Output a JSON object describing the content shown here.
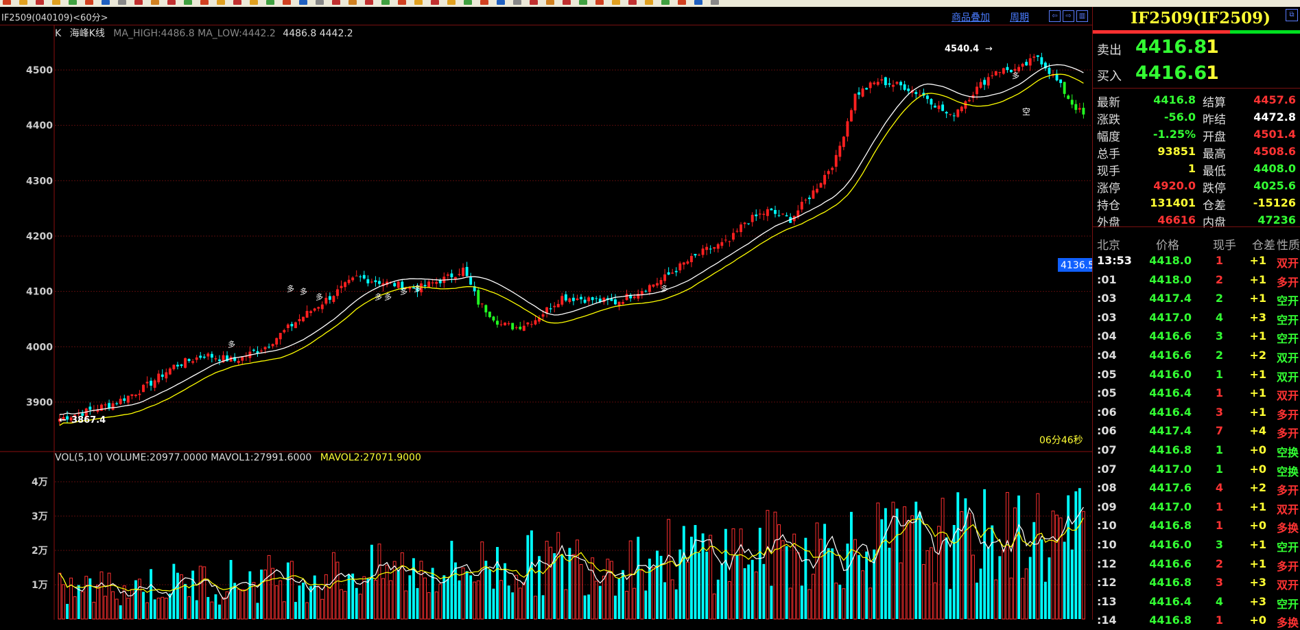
{
  "title_bar": {
    "symbol_label": "IF2509(040109)<60分>",
    "link_overlay": "商品叠加",
    "link_period": "周期"
  },
  "main_chart": {
    "indicator_k": "K",
    "indicator_name": "海峰K线",
    "ma_text": "MA_HIGH:4486.8 MA_LOW:4442.2",
    "ma_values": "4486.8 4442.2",
    "y_ticks": [
      "4500",
      "4400",
      "4300",
      "4200",
      "4100",
      "4000",
      "3900"
    ],
    "high_label": "4540.4",
    "low_label": "3867.4",
    "current_price_tag": "4136.5",
    "countdown": "06分46秒",
    "annotation_glyph": "多",
    "annotation_glyph_short": "空"
  },
  "volume_chart": {
    "legend_main": "VOL(5,10) VOLUME:20977.0000 MAVOL1:27991.6000",
    "legend_mavol2": "MAVOL2:27071.9000",
    "y_ticks": [
      "4万",
      "3万",
      "2万",
      "1万"
    ]
  },
  "chart_data": [
    {
      "type": "candlestick",
      "title": "海峰K线",
      "ylim": [
        3840,
        4580
      ],
      "y_ticks": [
        3900,
        4000,
        4100,
        4200,
        4300,
        4400,
        4500
      ],
      "annotations": [
        {
          "text": "4540.4",
          "value": 4540.4
        },
        {
          "text": "3867.4",
          "value": 3867.4
        }
      ],
      "series": [
        {
          "name": "MA_HIGH",
          "last": 4486.8
        },
        {
          "name": "MA_LOW",
          "last": 4442.2
        }
      ],
      "keypoints": [
        [
          0,
          3870
        ],
        [
          8,
          3885
        ],
        [
          15,
          3900
        ],
        [
          22,
          3925
        ],
        [
          30,
          3965
        ],
        [
          38,
          3985
        ],
        [
          46,
          3975
        ],
        [
          54,
          4000
        ],
        [
          62,
          4045
        ],
        [
          70,
          4085
        ],
        [
          78,
          4125
        ],
        [
          86,
          4115
        ],
        [
          94,
          4105
        ],
        [
          102,
          4125
        ],
        [
          106,
          4140
        ],
        [
          110,
          4080
        ],
        [
          116,
          4040
        ],
        [
          120,
          4035
        ],
        [
          125,
          4050
        ],
        [
          132,
          4090
        ],
        [
          140,
          4085
        ],
        [
          146,
          4080
        ],
        [
          152,
          4100
        ],
        [
          158,
          4120
        ],
        [
          164,
          4150
        ],
        [
          170,
          4175
        ],
        [
          176,
          4190
        ],
        [
          180,
          4225
        ],
        [
          186,
          4245
        ],
        [
          192,
          4230
        ],
        [
          198,
          4280
        ],
        [
          204,
          4340
        ],
        [
          209,
          4455
        ],
        [
          215,
          4480
        ],
        [
          222,
          4470
        ],
        [
          228,
          4450
        ],
        [
          234,
          4415
        ],
        [
          240,
          4460
        ],
        [
          246,
          4500
        ],
        [
          252,
          4500
        ],
        [
          257,
          4525
        ],
        [
          262,
          4480
        ],
        [
          266,
          4440
        ],
        [
          269,
          4418
        ]
      ]
    },
    {
      "type": "bar",
      "title": "VOL(5,10)",
      "ylim": [
        0,
        45000
      ],
      "y_ticks": [
        10000,
        20000,
        30000,
        40000
      ],
      "series": [
        {
          "name": "VOLUME",
          "last": 20977
        },
        {
          "name": "MAVOL1",
          "last": 27991.6
        },
        {
          "name": "MAVOL2",
          "last": 27071.9
        }
      ]
    }
  ],
  "right_panel": {
    "title": "IF2509(IF2509)",
    "sell_label": "卖出",
    "sell_price": "4416.8",
    "sell_vol": "1",
    "buy_label": "买入",
    "buy_price": "4416.6",
    "buy_vol": "1",
    "stats_left": [
      {
        "label": "最新",
        "value": "4416.8",
        "color": "green"
      },
      {
        "label": "涨跌",
        "value": "-56.0",
        "color": "green"
      },
      {
        "label": "幅度",
        "value": "-1.25%",
        "color": "green"
      },
      {
        "label": "总手",
        "value": "93851",
        "color": "yellow"
      },
      {
        "label": "现手",
        "value": "1",
        "color": "yellow"
      },
      {
        "label": "涨停",
        "value": "4920.0",
        "color": "red"
      },
      {
        "label": "持仓",
        "value": "131401",
        "color": "yellow"
      },
      {
        "label": "外盘",
        "value": "46616",
        "color": "red"
      }
    ],
    "stats_right": [
      {
        "label": "结算",
        "value": "4457.6",
        "color": "red"
      },
      {
        "label": "昨结",
        "value": "4472.8",
        "color": "white"
      },
      {
        "label": "开盘",
        "value": "4501.4",
        "color": "red"
      },
      {
        "label": "最高",
        "value": "4508.6",
        "color": "red"
      },
      {
        "label": "最低",
        "value": "4408.0",
        "color": "green"
      },
      {
        "label": "跌停",
        "value": "4025.6",
        "color": "green"
      },
      {
        "label": "仓差",
        "value": "-15126",
        "color": "yellow"
      },
      {
        "label": "内盘",
        "value": "47236",
        "color": "green"
      }
    ],
    "tick_headers": [
      "北京",
      "价格",
      "现手",
      "仓差",
      "性质"
    ],
    "ticks": [
      {
        "time": "13:53",
        "price": "4418.0",
        "vol": "1",
        "oi": "+1",
        "nature": "双开",
        "ncolor": "red"
      },
      {
        "time": ":01",
        "price": "4418.0",
        "vol": "2",
        "oi": "+1",
        "nature": "多开",
        "ncolor": "red"
      },
      {
        "time": ":03",
        "price": "4417.4",
        "vol": "2",
        "oi": "+1",
        "nature": "空开",
        "ncolor": "green"
      },
      {
        "time": ":03",
        "price": "4417.0",
        "vol": "4",
        "oi": "+3",
        "nature": "空开",
        "ncolor": "green"
      },
      {
        "time": ":04",
        "price": "4416.6",
        "vol": "3",
        "oi": "+1",
        "nature": "空开",
        "ncolor": "green"
      },
      {
        "time": ":04",
        "price": "4416.6",
        "vol": "2",
        "oi": "+2",
        "nature": "双开",
        "ncolor": "green"
      },
      {
        "time": ":05",
        "price": "4416.0",
        "vol": "1",
        "oi": "+1",
        "nature": "双开",
        "ncolor": "green"
      },
      {
        "time": ":05",
        "price": "4416.4",
        "vol": "1",
        "oi": "+1",
        "nature": "双开",
        "ncolor": "red"
      },
      {
        "time": ":06",
        "price": "4416.4",
        "vol": "3",
        "oi": "+1",
        "nature": "多开",
        "ncolor": "red"
      },
      {
        "time": ":06",
        "price": "4417.4",
        "vol": "7",
        "oi": "+4",
        "nature": "多开",
        "ncolor": "red"
      },
      {
        "time": ":07",
        "price": "4416.8",
        "vol": "1",
        "oi": "+0",
        "nature": "空换",
        "ncolor": "green"
      },
      {
        "time": ":07",
        "price": "4417.0",
        "vol": "1",
        "oi": "+0",
        "nature": "空换",
        "ncolor": "green"
      },
      {
        "time": ":08",
        "price": "4417.6",
        "vol": "4",
        "oi": "+2",
        "nature": "多开",
        "ncolor": "red"
      },
      {
        "time": ":09",
        "price": "4417.0",
        "vol": "1",
        "oi": "+1",
        "nature": "双开",
        "ncolor": "red"
      },
      {
        "time": ":10",
        "price": "4416.8",
        "vol": "1",
        "oi": "+0",
        "nature": "多换",
        "ncolor": "red"
      },
      {
        "time": ":10",
        "price": "4416.0",
        "vol": "3",
        "oi": "+1",
        "nature": "空开",
        "ncolor": "green"
      },
      {
        "time": ":12",
        "price": "4416.6",
        "vol": "2",
        "oi": "+1",
        "nature": "多开",
        "ncolor": "red"
      },
      {
        "time": ":12",
        "price": "4416.8",
        "vol": "3",
        "oi": "+3",
        "nature": "双开",
        "ncolor": "red"
      },
      {
        "time": ":13",
        "price": "4416.4",
        "vol": "4",
        "oi": "+3",
        "nature": "空开",
        "ncolor": "green"
      },
      {
        "time": ":14",
        "price": "4416.8",
        "vol": "1",
        "oi": "+0",
        "nature": "多换",
        "ncolor": "red"
      }
    ]
  }
}
